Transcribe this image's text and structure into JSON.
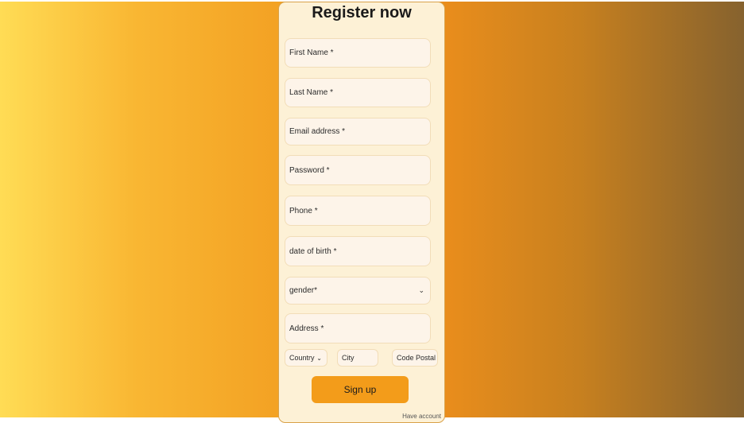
{
  "form": {
    "title": "Register now",
    "fields": [
      {
        "label": "First Name *"
      },
      {
        "label": "Last Name *"
      },
      {
        "label": "Email address *"
      },
      {
        "label": "Password *"
      },
      {
        "label": "Phone *"
      },
      {
        "label": "date of birth *"
      },
      {
        "label": "gender*"
      },
      {
        "label": "Address *"
      }
    ],
    "country": "Country",
    "city": "City",
    "postal": "Code Postal",
    "signup": "Sign up",
    "have_account": "Have account"
  },
  "colors": {
    "accent": "#f39c1a",
    "card": "#fdf1d6",
    "gradient_start": "#ffdc55",
    "gradient_end": "#86622e"
  },
  "icons": {
    "gender_select": "chevron-down-icon",
    "country_select": "chevron-down-icon"
  }
}
